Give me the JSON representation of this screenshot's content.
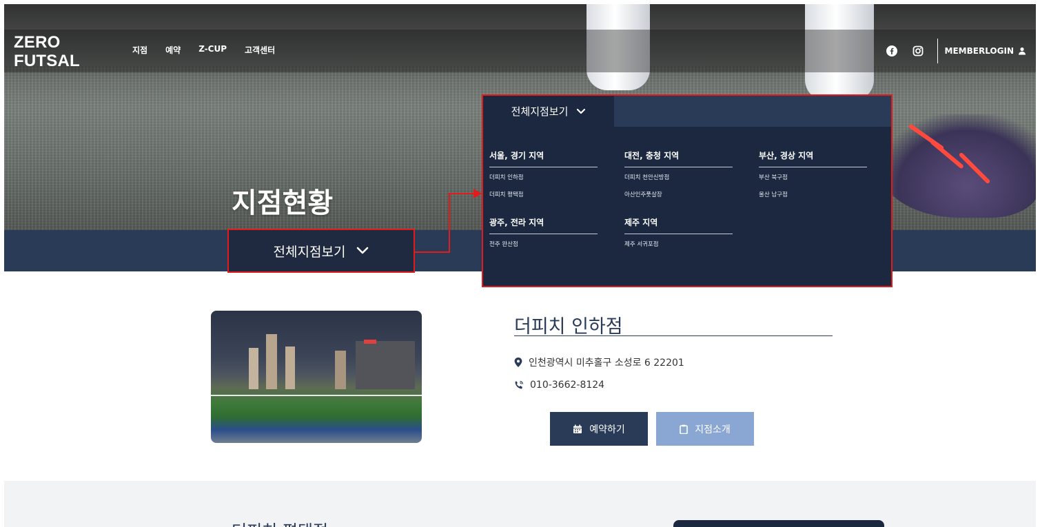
{
  "brand": {
    "logo_line1": "ZERO",
    "logo_line2": "FUTSAL"
  },
  "nav": {
    "items": [
      "지점",
      "예약",
      "Z-CUP",
      "고객센터"
    ]
  },
  "header": {
    "login_label": "MEMBERLOGIN"
  },
  "icons": {
    "facebook": "facebook-icon",
    "instagram": "instagram-icon",
    "user": "user-icon",
    "chevron": "chevron-down-icon",
    "pin": "map-pin-icon",
    "phone": "phone-icon",
    "calendar": "calendar-icon",
    "clipboard": "clipboard-icon"
  },
  "hero": {
    "title": "지점현황"
  },
  "selector": {
    "label": "전체지점보기"
  },
  "dropdown": {
    "tab_label": "전체지점보기",
    "regions": [
      {
        "title": "서울, 경기 지역",
        "items": [
          "더피치 인하점",
          "더피치 평택점"
        ]
      },
      {
        "title": "대전, 충청 지역",
        "items": [
          "더피치 천안신방점",
          "아산인주풋살장"
        ]
      },
      {
        "title": "부산, 경상 지역",
        "items": [
          "부산 북구점",
          "울산 남구점"
        ]
      },
      {
        "title": "광주, 전라 지역",
        "items": [
          "전주 완산점"
        ]
      },
      {
        "title": "제주 지역",
        "items": [
          "제주 서귀포점"
        ]
      }
    ]
  },
  "store": {
    "name": "더피치 인하점",
    "address": "인천광역시 미추홀구 소성로 6 22201",
    "phone": "010-3662-8124",
    "reserve_label": "예약하기",
    "intro_label": "지점소개"
  },
  "next_store": {
    "name": "더피치 평택점"
  },
  "colors": {
    "navy": "#2a3b58",
    "panel": "#1b2840",
    "accent_red": "#e41b1b",
    "light_blue": "#8aa6d3"
  }
}
